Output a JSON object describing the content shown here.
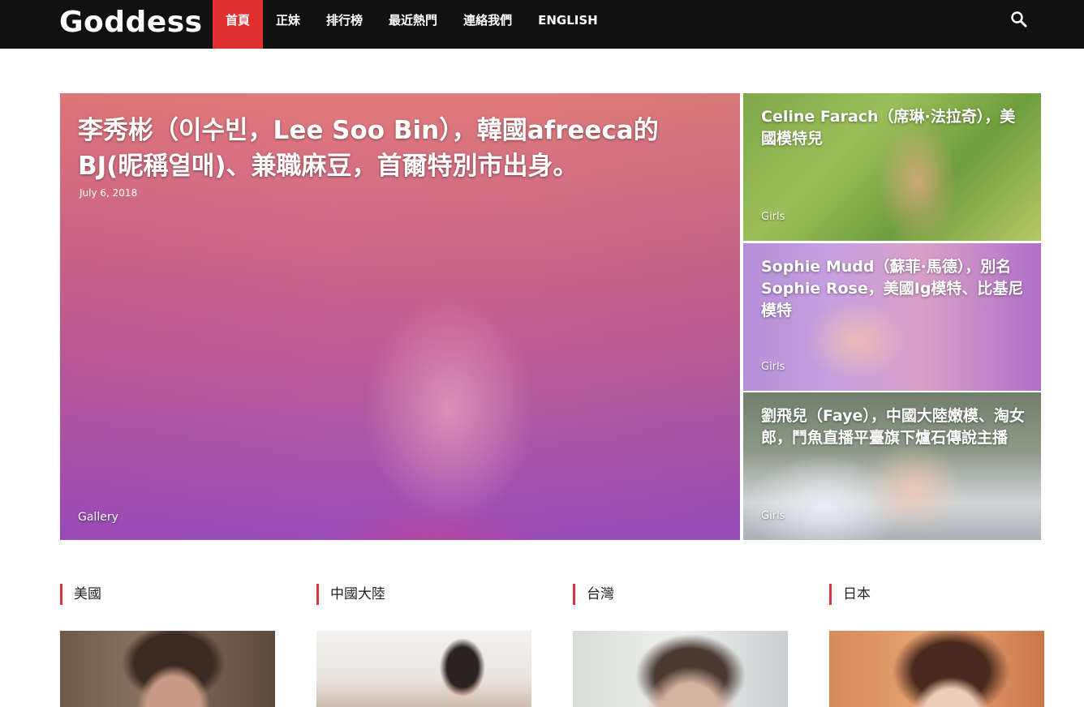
{
  "site": {
    "logo": "Goddess"
  },
  "nav": {
    "items": [
      {
        "label": "首頁",
        "active": true
      },
      {
        "label": "正妹",
        "active": false
      },
      {
        "label": "排行榜",
        "active": false
      },
      {
        "label": "最近熱門",
        "active": false
      },
      {
        "label": "連絡我們",
        "active": false
      },
      {
        "label": "ENGLISH",
        "active": false
      }
    ],
    "search_icon": "search-icon",
    "active_color": "#e03030"
  },
  "featured": {
    "main": {
      "title": "李秀彬（이수빈，Lee Soo Bin），韓國afreeca的BJ(昵稱열매)、兼職麻豆，首爾特別市出身。",
      "date": "July 6, 2018",
      "category": "Gallery"
    },
    "side": [
      {
        "title": "Celine Farach（席琳·法拉奇），美國模特兒",
        "category": "Girls"
      },
      {
        "title": "Sophie Mudd（蘇菲·馬德），別名Sophie Rose，美國Ig模特、比基尼模特",
        "category": "Girls"
      },
      {
        "title": "劉飛兒（Faye），中國大陸嫩模、淘女郎，鬥魚直播平臺旗下爐石傳說主播",
        "category": "Girls"
      }
    ]
  },
  "categories": [
    {
      "label": "美國"
    },
    {
      "label": "中國大陸"
    },
    {
      "label": "台灣"
    },
    {
      "label": "日本"
    }
  ],
  "colors": {
    "topbar": "#111111",
    "accent": "#d9363e"
  }
}
